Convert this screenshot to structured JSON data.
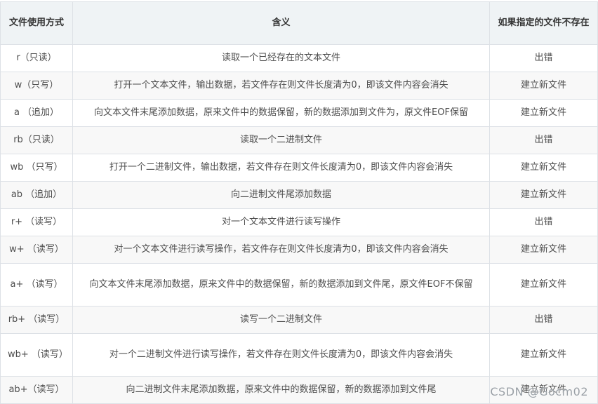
{
  "table": {
    "headers": [
      "文件使用方式",
      "含义",
      "如果指定的文件不存在"
    ],
    "rows": [
      {
        "mode": "r（只读）",
        "meaning": "读取一个已经存在的文本文件",
        "if_missing": "出错"
      },
      {
        "mode": "w（只写）",
        "meaning": "打开一个文本文件，输出数据，若文件存在则文件长度清为0，即该文件内容会消失",
        "if_missing": "建立新文件"
      },
      {
        "mode": "a （追加）",
        "meaning": "向文本文件末尾添加数据，原来文件中的数据保留，新的数据添加到文件为，原文件EOF保留",
        "if_missing": "建立新文件"
      },
      {
        "mode": "rb（只读）",
        "meaning": "读取一个二进制文件",
        "if_missing": "出错"
      },
      {
        "mode": "wb （只写）",
        "meaning": "打开一个二进制文件，输出数据，若文件存在则文件长度清为0，即该文件内容会消失",
        "if_missing": "建立新文件"
      },
      {
        "mode": "ab （追加）",
        "meaning": "向二进制文件尾添加数据",
        "if_missing": "建立新文件"
      },
      {
        "mode": "r+ （读写）",
        "meaning": "对一个文本文件进行读写操作",
        "if_missing": "出错"
      },
      {
        "mode": "w+ （读写）",
        "meaning": "对一个文本文件进行读写操作，若文件存在则文件长度清为0，即该文件内容会消失",
        "if_missing": "建立新文件"
      },
      {
        "mode": "a+ （读写）",
        "meaning": "向文本文件末尾添加数据，原来文件中的数据保留，新的数据添加到文件尾，原文件EOF不保留",
        "if_missing": "建立新文件"
      },
      {
        "mode": "rb+ （读写）",
        "meaning": "读写一个二进制文件",
        "if_missing": "出错"
      },
      {
        "mode": "wb+ （读写）",
        "meaning": "对一个二进制文件进行读写操作，若文件存在则文件长度清为0，即该文件内容会消失",
        "if_missing": "建立新文件"
      },
      {
        "mode": "ab+（读写）",
        "meaning": "向二进制文件末尾添加数据，原来文件中的数据保留，新的数据添加到文件尾",
        "if_missing": "建立新文件"
      }
    ]
  },
  "watermark": "CSDN @Gocm02"
}
